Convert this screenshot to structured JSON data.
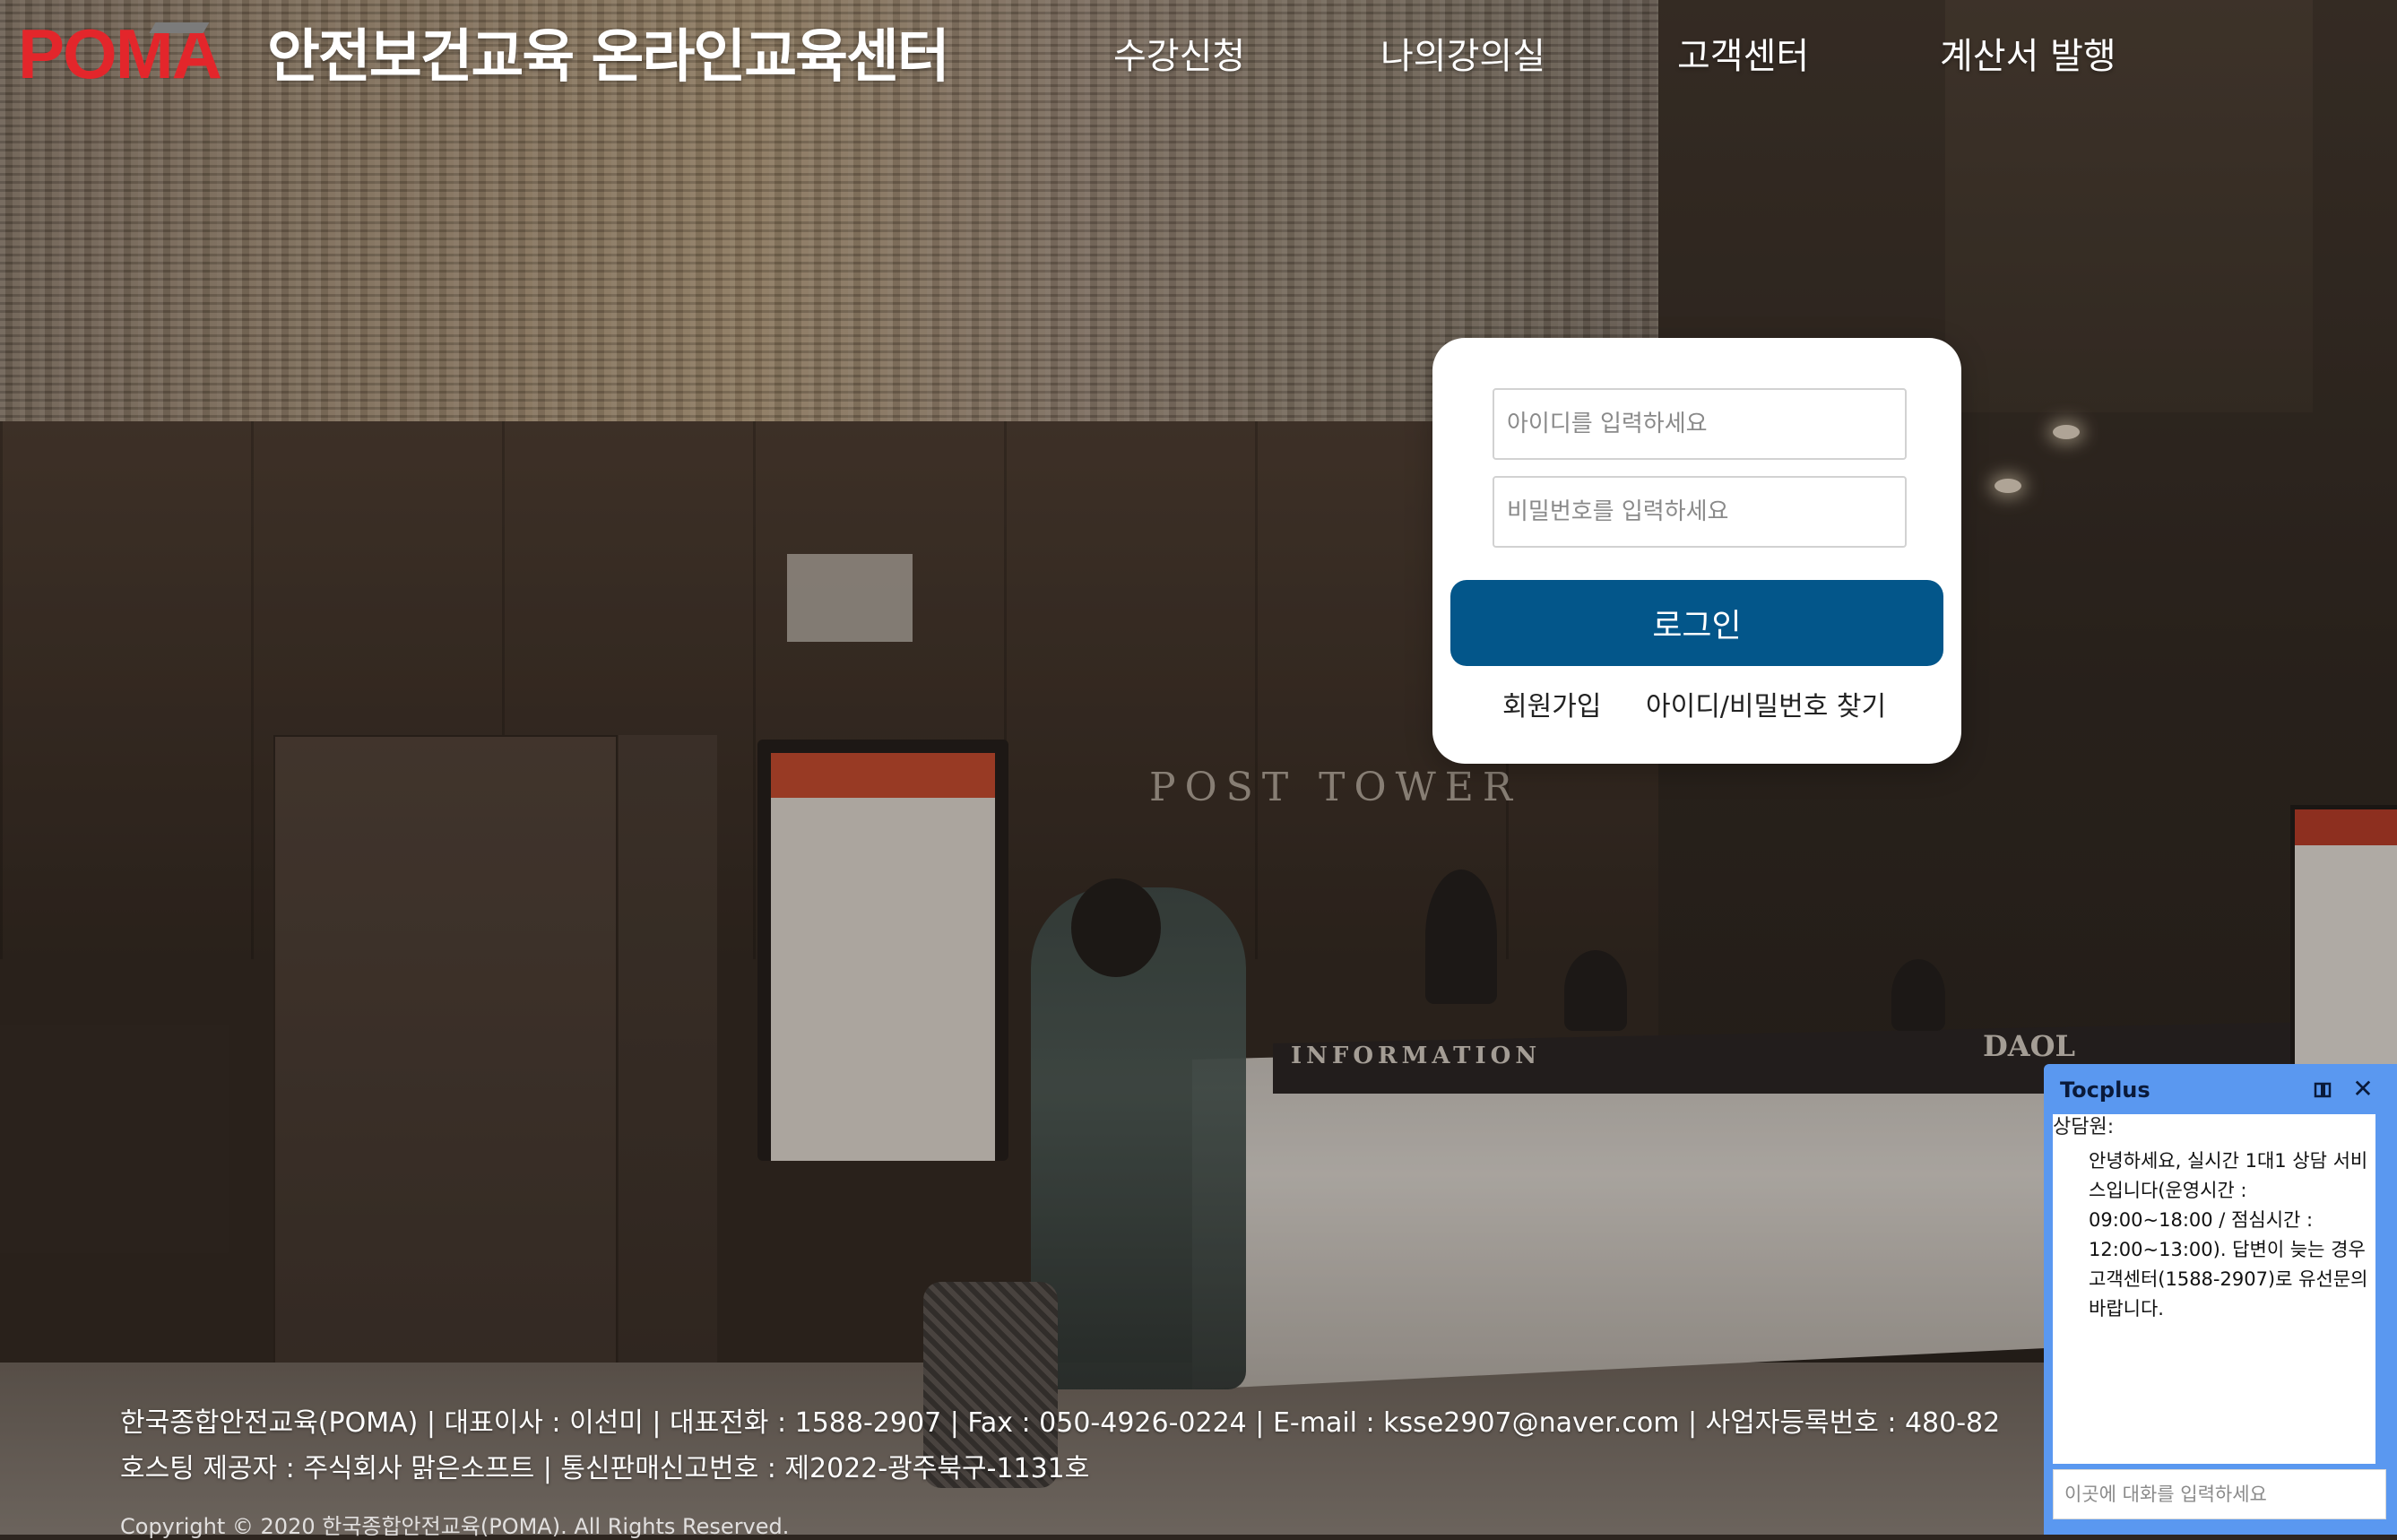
{
  "header": {
    "logo_text": "POMA",
    "site_title": "안전보건교육 온라인교육센터",
    "nav": [
      "수강신청",
      "나의강의실",
      "고객센터",
      "계산서 발행"
    ]
  },
  "background": {
    "sign_text": "POST TOWER",
    "desk_text": "INFORMATION",
    "brand_text": "DAOL"
  },
  "login": {
    "id_placeholder": "아이디를 입력하세요",
    "password_placeholder": "비밀번호를 입력하세요",
    "login_button": "로그인",
    "signup_link": "회원가입",
    "find_account_link": "아이디/비밀번호 찾기"
  },
  "footer": {
    "line1": "한국종합안전교육(POMA) | 대표이사 : 이선미 | 대표전화 : 1588-2907 | Fax : 050-4926-0224 | E-mail : ksse2907@naver.com | 사업자등록번호 : 480-82",
    "line2": "호스팅 제공자 : 주식회사 맑은소프트 | 통신판매신고번호 : 제2022-광주북구-1131호",
    "copyright": "Copyright © 2020 한국종합안전교육(POMA). All Rights Reserved."
  },
  "chat": {
    "title": "Tocplus",
    "sender": "상담원:",
    "message": "안녕하세요, 실시간 1대1 상담 서비스입니다(운영시간 : 09:00~18:00 / 점심시간 : 12:00~13:00). 답변이 늦는 경우 고객센터(1588-2907)로 유선문의 바랍니다.",
    "input_placeholder": "이곳에 대화를 입력하세요",
    "close_glyph": "✕"
  },
  "colors": {
    "brand_red": "#e3262b",
    "login_button": "#03568a",
    "chat_frame": "#5a98f0"
  }
}
